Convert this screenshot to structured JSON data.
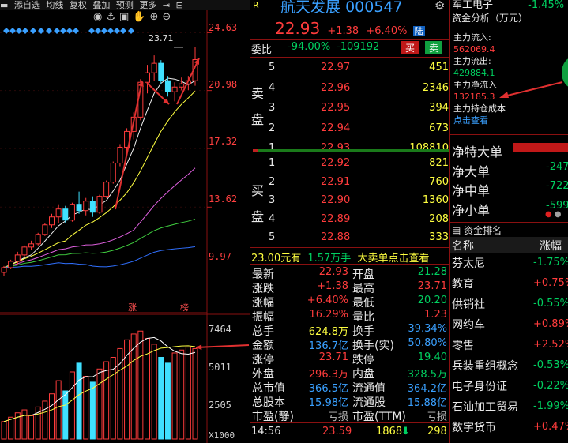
{
  "toolbar": {
    "items": [
      "添自选",
      "均线",
      "复权",
      "叠加",
      "预测",
      "更多"
    ]
  },
  "chart": {
    "price_ticks": [
      "24.63",
      "20.98",
      "17.32",
      "13.62",
      "9.97"
    ],
    "high_label": "23.71",
    "tags": [
      "涨",
      "榜"
    ],
    "volume_ticks": [
      "7464",
      "5011",
      "2505"
    ],
    "volume_unit": "X1000"
  },
  "chart_data": {
    "type": "candlestick",
    "price_range": [
      9.97,
      24.63
    ],
    "candles": [
      {
        "o": 9.5,
        "h": 9.9,
        "l": 9.3,
        "c": 9.8
      },
      {
        "o": 9.8,
        "h": 10.3,
        "l": 9.7,
        "c": 10.2
      },
      {
        "o": 10.2,
        "h": 10.8,
        "l": 10.0,
        "c": 10.6
      },
      {
        "o": 10.6,
        "h": 11.2,
        "l": 10.5,
        "c": 11.1
      },
      {
        "o": 11.1,
        "h": 11.5,
        "l": 10.9,
        "c": 11.3
      },
      {
        "o": 11.3,
        "h": 12.0,
        "l": 11.2,
        "c": 11.9
      },
      {
        "o": 11.9,
        "h": 12.6,
        "l": 11.8,
        "c": 12.5
      },
      {
        "o": 12.5,
        "h": 13.2,
        "l": 12.3,
        "c": 13.0
      },
      {
        "o": 13.0,
        "h": 13.8,
        "l": 12.6,
        "c": 13.5
      },
      {
        "o": 13.5,
        "h": 13.7,
        "l": 12.6,
        "c": 12.8
      },
      {
        "o": 12.8,
        "h": 13.9,
        "l": 12.7,
        "c": 13.8
      },
      {
        "o": 13.8,
        "h": 14.6,
        "l": 13.2,
        "c": 13.4
      },
      {
        "o": 13.4,
        "h": 14.2,
        "l": 13.1,
        "c": 14.0
      },
      {
        "o": 14.0,
        "h": 14.3,
        "l": 13.0,
        "c": 13.3
      },
      {
        "o": 13.3,
        "h": 14.4,
        "l": 13.2,
        "c": 14.3
      },
      {
        "o": 14.3,
        "h": 15.3,
        "l": 14.2,
        "c": 15.2
      },
      {
        "o": 15.2,
        "h": 16.5,
        "l": 15.1,
        "c": 16.4
      },
      {
        "o": 16.4,
        "h": 17.6,
        "l": 16.2,
        "c": 17.4
      },
      {
        "o": 17.4,
        "h": 18.6,
        "l": 17.1,
        "c": 18.4
      },
      {
        "o": 18.4,
        "h": 19.6,
        "l": 17.9,
        "c": 19.3
      },
      {
        "o": 19.3,
        "h": 21.7,
        "l": 19.1,
        "c": 21.5
      },
      {
        "o": 21.5,
        "h": 22.6,
        "l": 20.8,
        "c": 22.1
      },
      {
        "o": 22.1,
        "h": 23.2,
        "l": 21.6,
        "c": 22.7
      },
      {
        "o": 22.7,
        "h": 22.9,
        "l": 21.4,
        "c": 21.6
      },
      {
        "o": 21.6,
        "h": 21.9,
        "l": 20.6,
        "c": 20.9
      },
      {
        "o": 20.9,
        "h": 21.5,
        "l": 20.3,
        "c": 21.2
      },
      {
        "o": 21.2,
        "h": 21.8,
        "l": 21.0,
        "c": 21.4
      },
      {
        "o": 21.4,
        "h": 21.9,
        "l": 21.0,
        "c": 21.6
      },
      {
        "o": 21.6,
        "h": 23.71,
        "l": 21.28,
        "c": 22.93
      }
    ],
    "volumes": [
      1.2,
      1.5,
      1.8,
      2.0,
      1.6,
      2.2,
      2.6,
      3.1,
      4.0,
      3.3,
      4.6,
      5.2,
      4.3,
      3.9,
      4.8,
      5.3,
      5.6,
      6.2,
      6.8,
      7.2,
      7.4,
      6.9,
      6.5,
      5.6,
      5.2,
      5.9,
      6.1,
      6.3,
      6.2
    ],
    "volume_range": [
      0,
      7464
    ]
  },
  "quote": {
    "name": "航天发展",
    "code": "000547",
    "price": "22.93",
    "change": "+1.38",
    "pct": "+6.40%",
    "tag": "陆",
    "weibi_label": "委比",
    "weibi": "-94.00%",
    "weicha": "-109192",
    "buy_btn": "买",
    "sell_btn": "卖",
    "sell_label": [
      "卖",
      "盘"
    ],
    "buy_label": [
      "买",
      "盘"
    ],
    "asks": [
      {
        "lv": "5",
        "price": "22.97",
        "vol": "451"
      },
      {
        "lv": "4",
        "price": "22.96",
        "vol": "2346"
      },
      {
        "lv": "3",
        "price": "22.95",
        "vol": "394"
      },
      {
        "lv": "2",
        "price": "22.94",
        "vol": "673"
      },
      {
        "lv": "1",
        "price": "22.93",
        "vol": "108810"
      }
    ],
    "bids": [
      {
        "lv": "1",
        "price": "22.92",
        "vol": "821"
      },
      {
        "lv": "2",
        "price": "22.91",
        "vol": "760"
      },
      {
        "lv": "3",
        "price": "22.90",
        "vol": "1360"
      },
      {
        "lv": "4",
        "price": "22.89",
        "vol": "208"
      },
      {
        "lv": "5",
        "price": "22.88",
        "vol": "333"
      }
    ],
    "big_order": {
      "price": "23.00元有",
      "vol": "1.57万手",
      "text": "大卖单点击查看"
    },
    "stats_left": [
      {
        "label": "最新",
        "value": "22.93"
      },
      {
        "label": "涨跌",
        "value": "+1.38"
      },
      {
        "label": "涨幅",
        "value": "+6.40%"
      },
      {
        "label": "振幅",
        "value": "16.29%"
      },
      {
        "label": "总手",
        "value": "624.8万"
      },
      {
        "label": "金额",
        "value": "136.7亿"
      },
      {
        "label": "涨停",
        "value": "23.71"
      },
      {
        "label": "外盘",
        "value": "296.3万"
      },
      {
        "label": "总市值",
        "value": "366.5亿"
      },
      {
        "label": "总股本",
        "value": "15.98亿"
      },
      {
        "label": "市盈(静)",
        "value": "亏损"
      }
    ],
    "stats_right": [
      {
        "label": "开盘",
        "value": "21.28"
      },
      {
        "label": "最高",
        "value": "23.71"
      },
      {
        "label": "最低",
        "value": "20.20"
      },
      {
        "label": "量比",
        "value": "1.23"
      },
      {
        "label": "换手",
        "value": "39.34%"
      },
      {
        "label": "换手(实)",
        "value": "50.80%"
      },
      {
        "label": "跌停",
        "value": "19.40"
      },
      {
        "label": "内盘",
        "value": "328.5万"
      },
      {
        "label": "流通值",
        "value": "364.2亿"
      },
      {
        "label": "流通股",
        "value": "15.88亿"
      },
      {
        "label": "市盈(TTM)",
        "value": "亏损"
      }
    ],
    "tick": {
      "time": "14:56",
      "price": "23.59",
      "vol": "1868",
      "num": "298"
    }
  },
  "right_panel": {
    "top_name": "军工电子",
    "top_pct": "-1.45%",
    "fund_title": "资金分析（万元）",
    "main_in_label": "主力流入:",
    "main_in": "562069.4",
    "main_out_label": "主力流出:",
    "main_out": "429884.1",
    "net_label": "主力净流入",
    "net": "132185.3",
    "cost_label": "主力持仓成本",
    "click_view": "点击查看",
    "net_rows": [
      {
        "label": "净特大单",
        "value": ""
      },
      {
        "label": "净大单",
        "value": "-247"
      },
      {
        "label": "净中单",
        "value": "-722"
      },
      {
        "label": "净小单",
        "value": "-599"
      }
    ],
    "rank_title": "资金排名",
    "rank_header": {
      "name": "名称",
      "pct": "涨幅"
    },
    "sectors": [
      {
        "name": "芬太尼",
        "pct": "-1.75%"
      },
      {
        "name": "教育",
        "pct": "+0.75%"
      },
      {
        "name": "供销社",
        "pct": "-0.55%"
      },
      {
        "name": "网约车",
        "pct": "+0.89%"
      },
      {
        "name": "零售",
        "pct": "+2.52%"
      },
      {
        "name": "兵装重组概念",
        "pct": "-0.53%"
      },
      {
        "name": "电子身份证",
        "pct": "-0.22%"
      },
      {
        "name": "石油加工贸易",
        "pct": "-1.99%"
      },
      {
        "name": "数字货币",
        "pct": "+0.47%"
      }
    ]
  }
}
